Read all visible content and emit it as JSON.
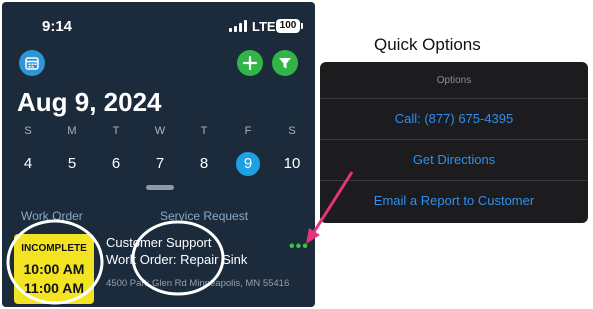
{
  "status_bar": {
    "time": "9:14",
    "network": "LTE",
    "battery": "100"
  },
  "header": {
    "calendar_icon": "calendar-icon",
    "add_icon": "plus-icon",
    "filter_icon": "filter-icon",
    "date_title": "Aug 9, 2024"
  },
  "week": {
    "days": [
      "S",
      "M",
      "T",
      "W",
      "T",
      "F",
      "S"
    ],
    "dates": [
      "4",
      "5",
      "6",
      "7",
      "8",
      "9",
      "10"
    ],
    "selected_index": 5
  },
  "columns": {
    "work_order": "Work Order",
    "service_request": "Service Request"
  },
  "job": {
    "status": "INCOMPLETE",
    "start_time": "10:00 AM",
    "end_time": "11:00 AM",
    "customer": "Customer Support",
    "title": "Work Order: Repair Sink",
    "address": "4500 Park Glen Rd Minneapolis, MN 55416",
    "more": "•••"
  },
  "quick_options": {
    "title": "Quick Options",
    "header": "Options",
    "items": [
      "Call: (877) 675-4395",
      "Get Directions",
      "Email a Report to Customer"
    ]
  },
  "colors": {
    "phone_bg": "#1b2b3c",
    "accent_blue": "#1ea1e3",
    "accent_green": "#31b545",
    "badge_yellow": "#f3e423",
    "arrow_pink": "#e8337c",
    "option_blue": "#2f8ff0"
  }
}
